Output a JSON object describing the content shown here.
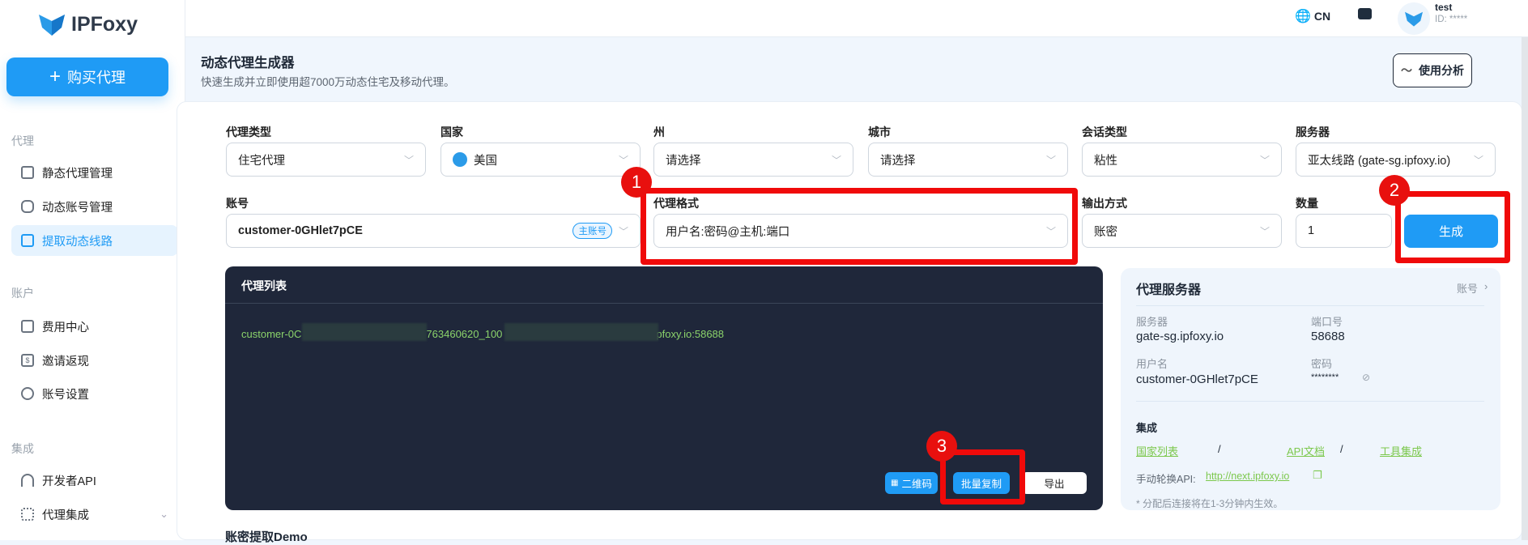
{
  "brand": {
    "name": "IPFoxy"
  },
  "sidebar": {
    "buy_label": "购买代理",
    "sections": [
      {
        "title": "代理",
        "items": [
          {
            "label": "静态代理管理"
          },
          {
            "label": "动态账号管理"
          },
          {
            "label": "提取动态线路"
          }
        ]
      },
      {
        "title": "账户",
        "items": [
          {
            "label": "费用中心"
          },
          {
            "label": "邀请返现"
          },
          {
            "label": "账号设置"
          }
        ]
      },
      {
        "title": "集成",
        "items": [
          {
            "label": "开发者API"
          },
          {
            "label": "代理集成"
          }
        ]
      }
    ]
  },
  "header": {
    "language": "CN",
    "user_name": "test",
    "user_id": "ID: *****"
  },
  "page": {
    "title": "动态代理生成器",
    "subtitle": "快速生成并立即使用超7000万动态住宅及移动代理。",
    "usage_button": "使用分析"
  },
  "form": {
    "proxy_type": {
      "label": "代理类型",
      "value": "住宅代理"
    },
    "country": {
      "label": "国家",
      "value": "美国"
    },
    "state": {
      "label": "州",
      "value": "请选择"
    },
    "city": {
      "label": "城市",
      "value": "请选择"
    },
    "session": {
      "label": "会话类型",
      "value": "粘性"
    },
    "server": {
      "label": "服务器",
      "value": "亚太线路 (gate-sg.ipfoxy.io)"
    },
    "account": {
      "label": "账号",
      "value": "customer-0GHlet7pCE",
      "badge": "主账号"
    },
    "format": {
      "label": "代理格式",
      "value": "用户名:密码@主机:端口"
    },
    "output": {
      "label": "输出方式",
      "value": "账密"
    },
    "quantity": {
      "label": "数量",
      "value": "1"
    },
    "generate": "生成"
  },
  "annotations": [
    "1",
    "2",
    "3"
  ],
  "proxy_list": {
    "title": "代理列表",
    "line_parts": [
      "customer-0C",
      "763460620_100",
      "pfoxy.io:58688"
    ],
    "qr_button": "二维码",
    "copy_button": "批量复制",
    "export_button": "导出"
  },
  "server_panel": {
    "title": "代理服务器",
    "account_link": "账号",
    "server_label": "服务器",
    "server_value": "gate-sg.ipfoxy.io",
    "port_label": "端口号",
    "port_value": "58688",
    "user_label": "用户名",
    "user_value": "customer-0GHlet7pCE",
    "pass_label": "密码",
    "pass_value": "********",
    "integration_title": "集成",
    "links": [
      "国家列表",
      "API文档",
      "工具集成"
    ],
    "sep": "/",
    "rotate_label": "手动轮换API:",
    "rotate_url": "http://next.ipfoxy.io",
    "note": "* 分配后连接将在1-3分钟内生效。"
  },
  "demo_title": "账密提取Demo",
  "colors": {
    "accent": "#1f9bf5",
    "annotation": "#f00a0a",
    "panel_dark": "#1f273a",
    "proxy_text": "#8bd36b"
  }
}
